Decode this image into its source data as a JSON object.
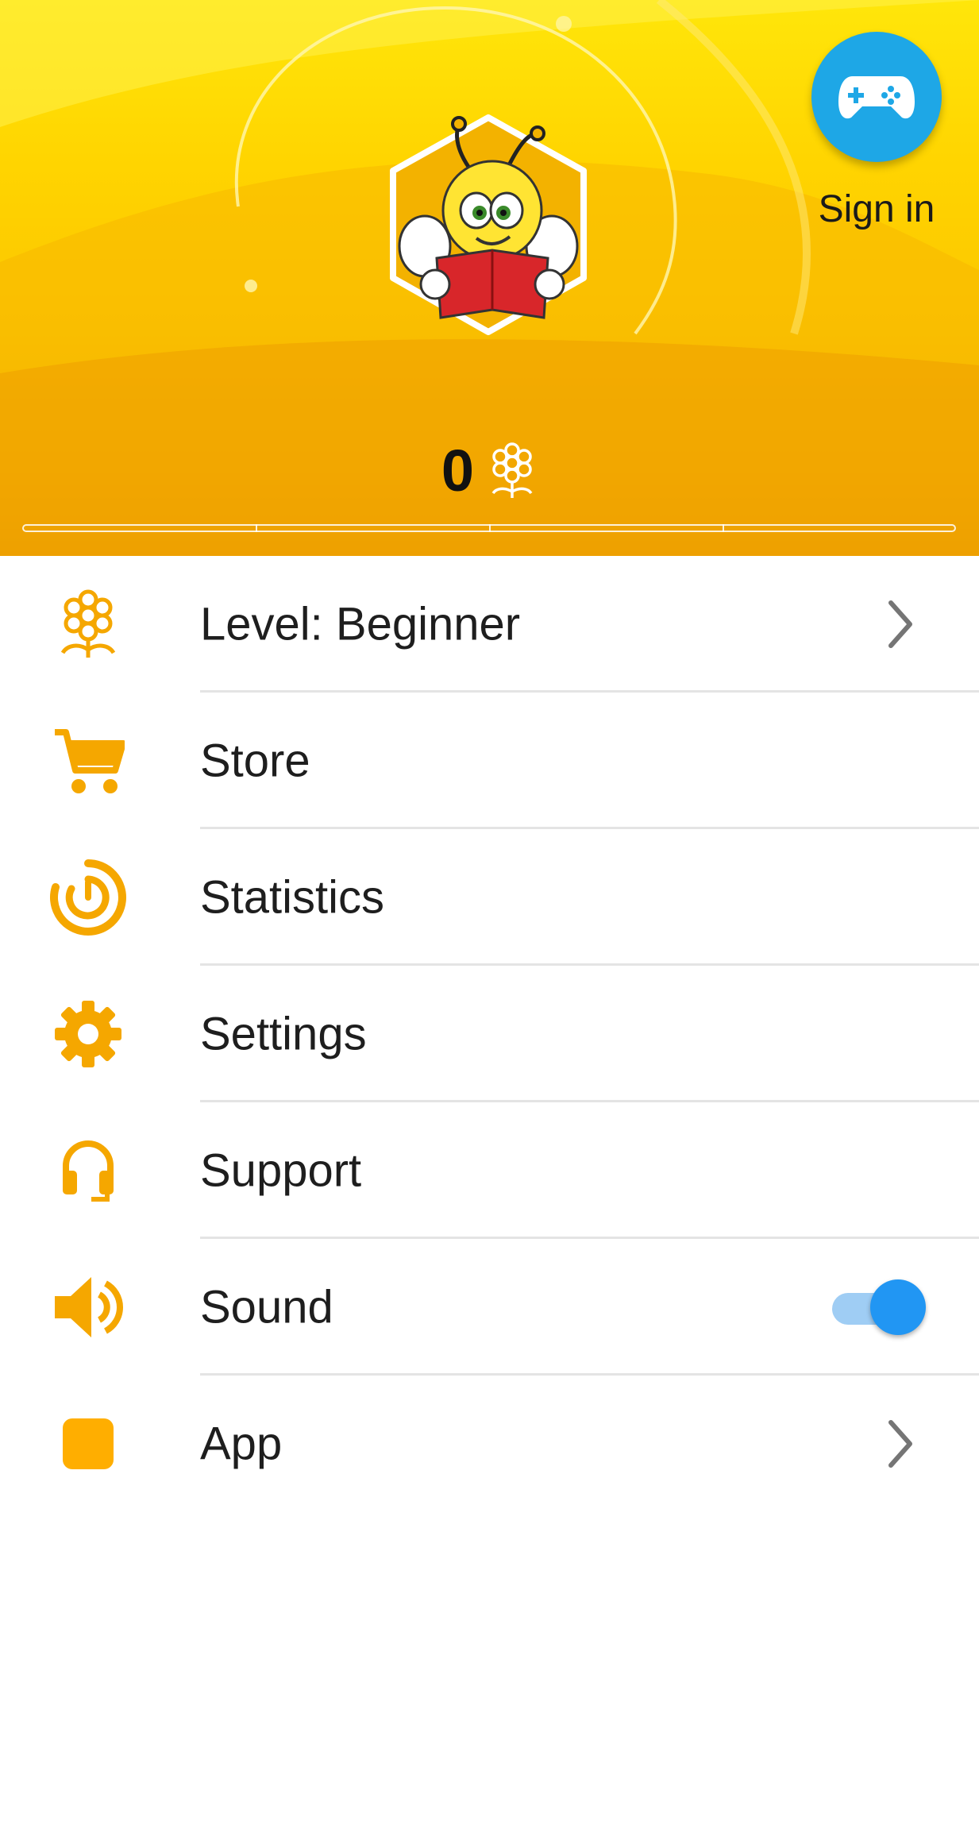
{
  "header": {
    "signin_label": "Sign in",
    "score": "0",
    "progress": 0.0,
    "progress_segments": 4
  },
  "menu": {
    "items": [
      {
        "label": "Level: Beginner",
        "icon": "flower-icon",
        "trailing": "chevron"
      },
      {
        "label": "Store",
        "icon": "cart-icon",
        "trailing": null
      },
      {
        "label": "Statistics",
        "icon": "statistics-icon",
        "trailing": null
      },
      {
        "label": "Settings",
        "icon": "gear-icon",
        "trailing": null
      },
      {
        "label": "Support",
        "icon": "headset-icon",
        "trailing": null
      },
      {
        "label": "Sound",
        "icon": "speaker-icon",
        "trailing": "toggle",
        "toggle_on": true
      },
      {
        "label": "App",
        "icon": "app-square-icon",
        "trailing": "chevron"
      }
    ]
  },
  "colors": {
    "accent": "#f5a700",
    "signin_button": "#1ea7e6",
    "toggle_on": "#2196f3",
    "header_yellow": "#ffd400"
  }
}
